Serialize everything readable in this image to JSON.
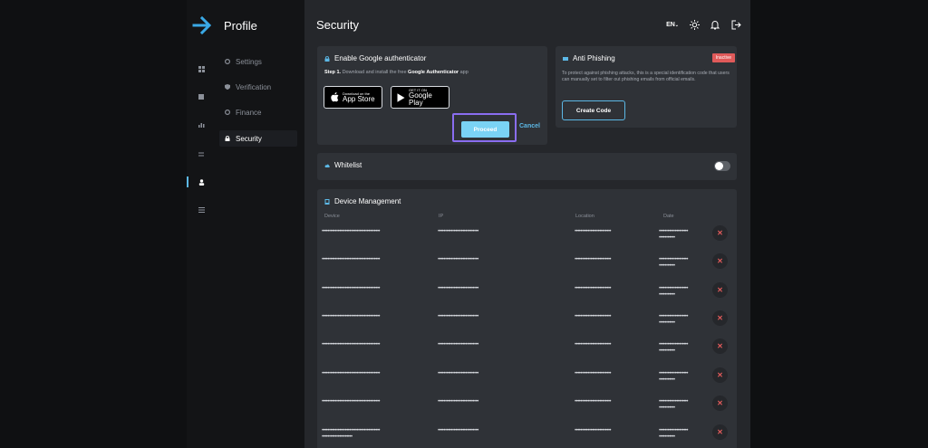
{
  "header": {
    "profile_title": "Profile",
    "page_title": "Security",
    "language": "EN"
  },
  "nav": {
    "items": [
      {
        "label": "Settings",
        "icon": "gear-icon"
      },
      {
        "label": "Verification",
        "icon": "shield-icon"
      },
      {
        "label": "Finance",
        "icon": "gear-icon"
      },
      {
        "label": "Security",
        "icon": "lock-icon"
      }
    ]
  },
  "google_auth": {
    "title": "Enable Google authenticator",
    "step_label": "Step 1.",
    "step_text_a": " Download and install the free ",
    "step_app": "Google Authenticator",
    "step_text_b": " app",
    "app_store_small": "Download on the",
    "app_store_big": "App Store",
    "google_play_small": "GET IT ON",
    "google_play_big": "Google Play",
    "proceed": "Proceed",
    "cancel": "Cancel"
  },
  "anti_phishing": {
    "title": "Anti Phishing",
    "status": "Inactive",
    "description": "To protect against phishing attacks, this is a special identification code that users can manually set to filter out phishing emails from official emails.",
    "button": "Create Code"
  },
  "whitelist": {
    "title": "Whitelist",
    "enabled": false
  },
  "devices": {
    "title": "Device Management",
    "columns": {
      "device": "Device",
      "ip": "IP",
      "location": "Location",
      "date": "Date"
    },
    "rows": [
      {
        "device": "••••••••••••••••••••••••••••••••••••••••",
        "ip": "••••••••••••••••••••••••••••",
        "location": "•••••••••••••••••••••••••",
        "date_a": "••••••••••••••••••••",
        "date_b": "•••••••••••"
      },
      {
        "device": "••••••••••••••••••••••••••••••••••••••••",
        "ip": "••••••••••••••••••••••••••••",
        "location": "•••••••••••••••••••••••••",
        "date_a": "••••••••••••••••••••",
        "date_b": "•••••••••••"
      },
      {
        "device": "••••••••••••••••••••••••••••••••••••••••",
        "ip": "••••••••••••••••••••••••••••",
        "location": "•••••••••••••••••••••••••",
        "date_a": "••••••••••••••••••••",
        "date_b": "•••••••••••"
      },
      {
        "device": "••••••••••••••••••••••••••••••••••••••••",
        "ip": "••••••••••••••••••••••••••••",
        "location": "•••••••••••••••••••••••••",
        "date_a": "••••••••••••••••••••",
        "date_b": "•••••••••••"
      },
      {
        "device": "••••••••••••••••••••••••••••••••••••••••",
        "ip": "••••••••••••••••••••••••••••",
        "location": "•••••••••••••••••••••••••",
        "date_a": "••••••••••••••••••••",
        "date_b": "•••••••••••"
      },
      {
        "device": "••••••••••••••••••••••••••••••••••••••••",
        "ip": "••••••••••••••••••••••••••••",
        "location": "•••••••••••••••••••••••••",
        "date_a": "••••••••••••••••••••",
        "date_b": "•••••••••••"
      },
      {
        "device": "••••••••••••••••••••••••••••••••••••••••",
        "ip": "••••••••••••••••••••••••••••",
        "location": "•••••••••••••••••••••••••",
        "date_a": "••••••••••••••••••••",
        "date_b": "•••••••••••"
      }
    ],
    "last_row": {
      "device": "••••••••••••••••••••••••••••••••••••••••",
      "device_b": "•••••••••••••••••••••",
      "ip": "••••••••••••••••••••••••••••",
      "location": "•••••••••••••••••••••••••",
      "date_a": "••••••••••••••••••••",
      "date_b": "•••••••••••"
    }
  },
  "colors": {
    "accent": "#5cb8e6",
    "danger": "#e05a5a",
    "highlight": "#8a6df0",
    "primary_button": "#7ad3f5"
  }
}
